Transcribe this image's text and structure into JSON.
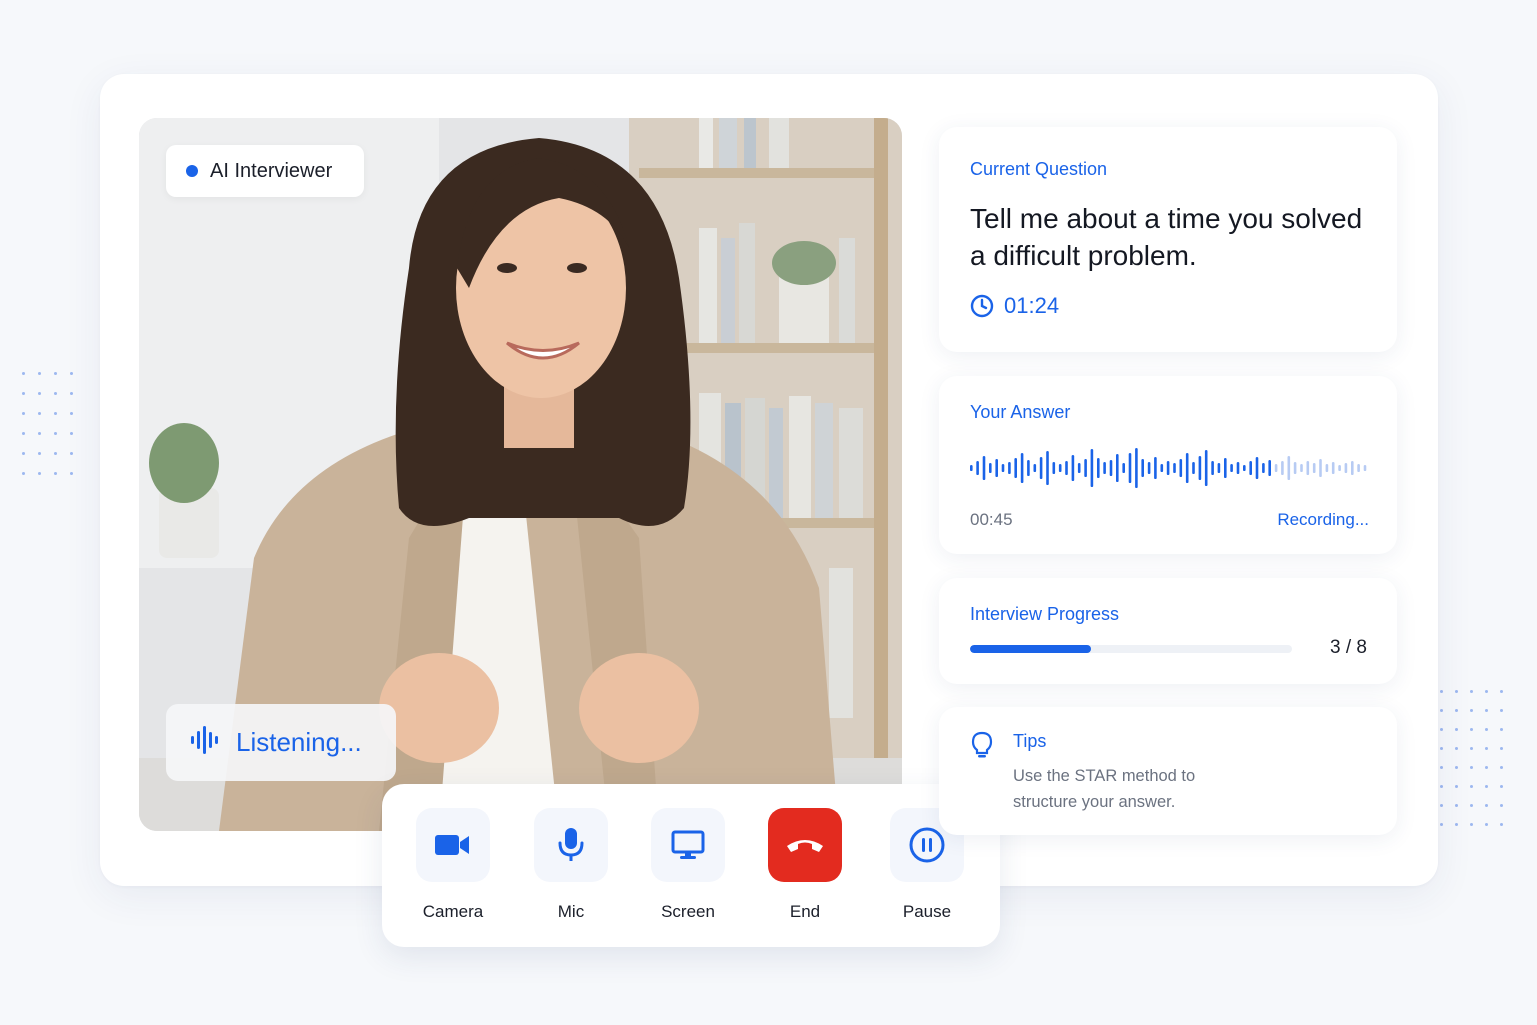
{
  "video": {
    "badge_label": "AI Interviewer",
    "listening_label": "Listening..."
  },
  "controls": [
    {
      "id": "camera",
      "label": "Camera",
      "icon": "camera-icon"
    },
    {
      "id": "mic",
      "label": "Mic",
      "icon": "mic-icon"
    },
    {
      "id": "screen",
      "label": "Screen",
      "icon": "screen-icon"
    },
    {
      "id": "end",
      "label": "End",
      "icon": "end-call-icon"
    },
    {
      "id": "pause",
      "label": "Pause",
      "icon": "pause-icon"
    }
  ],
  "question": {
    "heading": "Current Question",
    "text": "Tell me about a time you solved a difficult problem.",
    "timer": "01:24"
  },
  "answer": {
    "heading": "Your Answer",
    "elapsed": "00:45",
    "status": "Recording..."
  },
  "progress": {
    "heading": "Interview Progress",
    "current": 3,
    "total": 8,
    "label": "3 / 8"
  },
  "tips": {
    "heading": "Tips",
    "body": "Use the STAR method to structure your answer."
  },
  "colors": {
    "accent": "#1a63e8",
    "end_call": "#e32b1f",
    "muted_text": "#6b7280"
  }
}
